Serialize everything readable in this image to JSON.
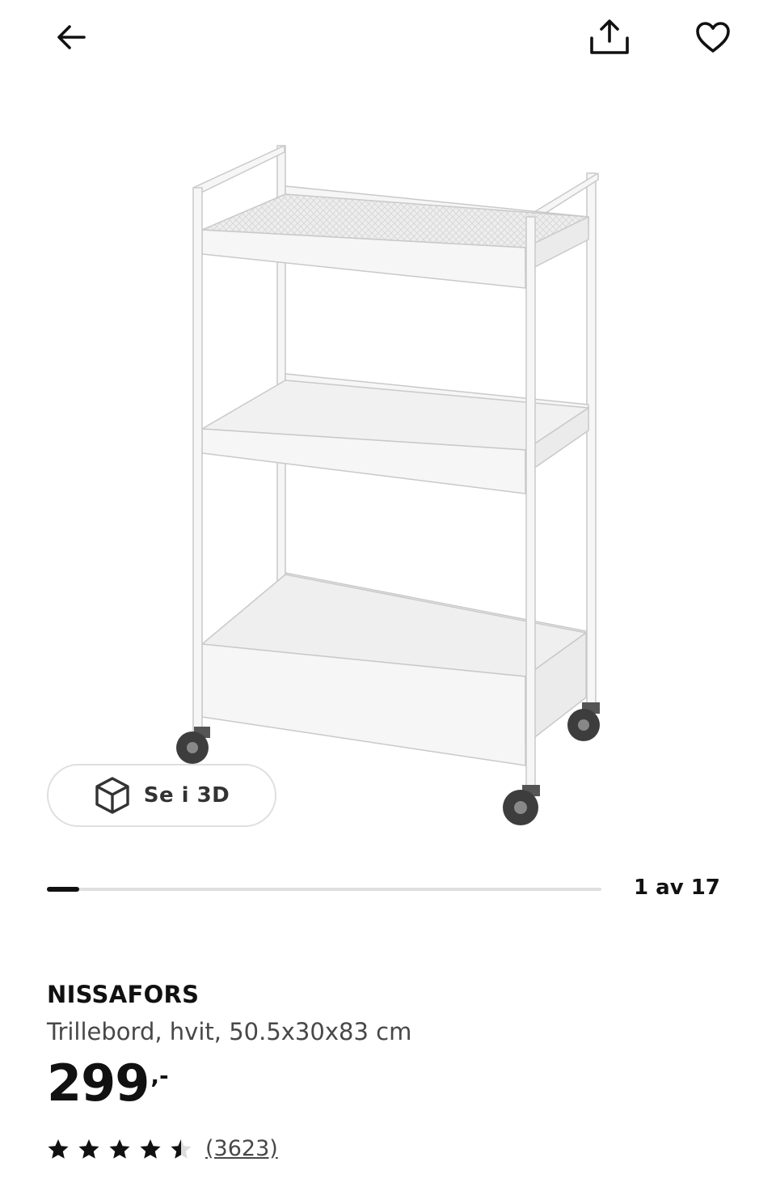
{
  "header": {
    "back_icon": "arrow-left-icon",
    "share_icon": "share-icon",
    "favorite_icon": "heart-icon"
  },
  "gallery": {
    "image_alt": "NISSAFORS",
    "view_3d_label": "Se i 3D",
    "view_3d_icon": "cube-icon",
    "counter": "1 av 17",
    "current": 1,
    "total": 17
  },
  "product": {
    "name": "NISSAFORS",
    "description": "Trillebord, hvit, 50.5x30x83 cm",
    "price": "299",
    "price_suffix": ",-",
    "rating": 4.5,
    "rating_max": 5,
    "review_count": "(3623)"
  },
  "colors": {
    "text": "#111111",
    "secondary_text": "#484848",
    "border": "#dfdfdf"
  }
}
